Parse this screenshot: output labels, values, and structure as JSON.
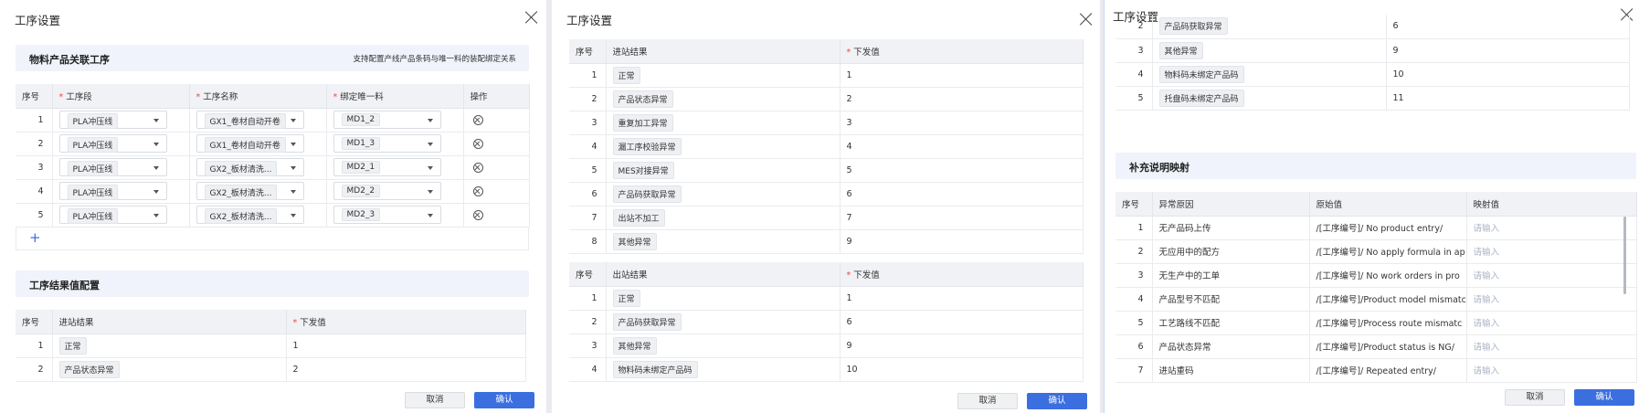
{
  "panel1": {
    "title": "工序设置",
    "section1": {
      "title": "物料产品关联工序",
      "hint": "支持配置产线产品条码与唯一料的装配绑定关系"
    },
    "table1": {
      "headers": [
        "序号",
        "工序段",
        "工序名称",
        "绑定唯一料",
        "操作"
      ],
      "rows": [
        {
          "no": "1",
          "segment": "PLA冲压线",
          "process": "GX1_卷材自动开卷",
          "material": "MD1_2"
        },
        {
          "no": "2",
          "segment": "PLA冲压线",
          "process": "GX1_卷材自动开卷",
          "material": "MD1_3"
        },
        {
          "no": "3",
          "segment": "PLA冲压线",
          "process": "GX2_板材清洗...",
          "material": "MD2_1"
        },
        {
          "no": "4",
          "segment": "PLA冲压线",
          "process": "GX2_板材清洗...",
          "material": "MD2_2"
        },
        {
          "no": "5",
          "segment": "PLA冲压线",
          "process": "GX2_板材清洗...",
          "material": "MD2_3"
        }
      ],
      "add_label": "+"
    },
    "section2": {
      "title": "工序结果值配置"
    },
    "table2": {
      "headers": [
        "序号",
        "进站结果",
        "下发值"
      ],
      "rows": [
        {
          "no": "1",
          "result": "正常",
          "value": "1"
        },
        {
          "no": "2",
          "result": "产品状态异常",
          "value": "2"
        }
      ]
    },
    "cancel": "取消",
    "ok": "确认"
  },
  "panel2": {
    "title": "工序设置",
    "in_table": {
      "headers": [
        "序号",
        "进站结果",
        "下发值"
      ],
      "rows": [
        {
          "no": "1",
          "result": "正常",
          "value": "1"
        },
        {
          "no": "2",
          "result": "产品状态异常",
          "value": "2"
        },
        {
          "no": "3",
          "result": "重复加工异常",
          "value": "3"
        },
        {
          "no": "4",
          "result": "漏工序校验异常",
          "value": "4"
        },
        {
          "no": "5",
          "result": "MES对接异常",
          "value": "5"
        },
        {
          "no": "6",
          "result": "产品码获取异常",
          "value": "6"
        },
        {
          "no": "7",
          "result": "出站不加工",
          "value": "7"
        },
        {
          "no": "8",
          "result": "其他异常",
          "value": "9"
        }
      ]
    },
    "out_table": {
      "headers": [
        "序号",
        "出站结果",
        "下发值"
      ],
      "rows": [
        {
          "no": "1",
          "result": "正常",
          "value": "1"
        },
        {
          "no": "2",
          "result": "产品码获取异常",
          "value": "6"
        },
        {
          "no": "3",
          "result": "其他异常",
          "value": "9"
        },
        {
          "no": "4",
          "result": "物料码未绑定产品码",
          "value": "10"
        }
      ]
    },
    "cancel": "取消",
    "ok": "确认"
  },
  "panel3": {
    "title": "工序设置",
    "top_table": {
      "rows": [
        {
          "no": "2",
          "result": "产品码获取异常",
          "value": "6"
        },
        {
          "no": "3",
          "result": "其他异常",
          "value": "9"
        },
        {
          "no": "4",
          "result": "物料码未绑定产品码",
          "value": "10"
        },
        {
          "no": "5",
          "result": "托盘码未绑定产品码",
          "value": "11"
        }
      ]
    },
    "section": {
      "title": "补充说明映射"
    },
    "map_table": {
      "headers": [
        "序号",
        "异常原因",
        "原始值",
        "映射值"
      ],
      "placeholder": "请输入",
      "rows": [
        {
          "no": "1",
          "reason": "无产品码上传",
          "raw": "/[工序编号]/ No product entry/"
        },
        {
          "no": "2",
          "reason": "无应用中的配方",
          "raw": "/[工序编号]/ No apply formula in ap"
        },
        {
          "no": "3",
          "reason": "无生产中的工单",
          "raw": "/[工序编号]/ No work orders in pro"
        },
        {
          "no": "4",
          "reason": "产品型号不匹配",
          "raw": "/[工序编号]/Product model mismatc"
        },
        {
          "no": "5",
          "reason": "工艺路线不匹配",
          "raw": "/[工序编号]/Process route mismatc"
        },
        {
          "no": "6",
          "reason": "产品状态异常",
          "raw": "/[工序编号]/Product status is NG/"
        },
        {
          "no": "7",
          "reason": "进站重码",
          "raw": "/[工序编号]/ Repeated entry/"
        }
      ]
    },
    "cancel": "取消",
    "ok": "确认"
  }
}
